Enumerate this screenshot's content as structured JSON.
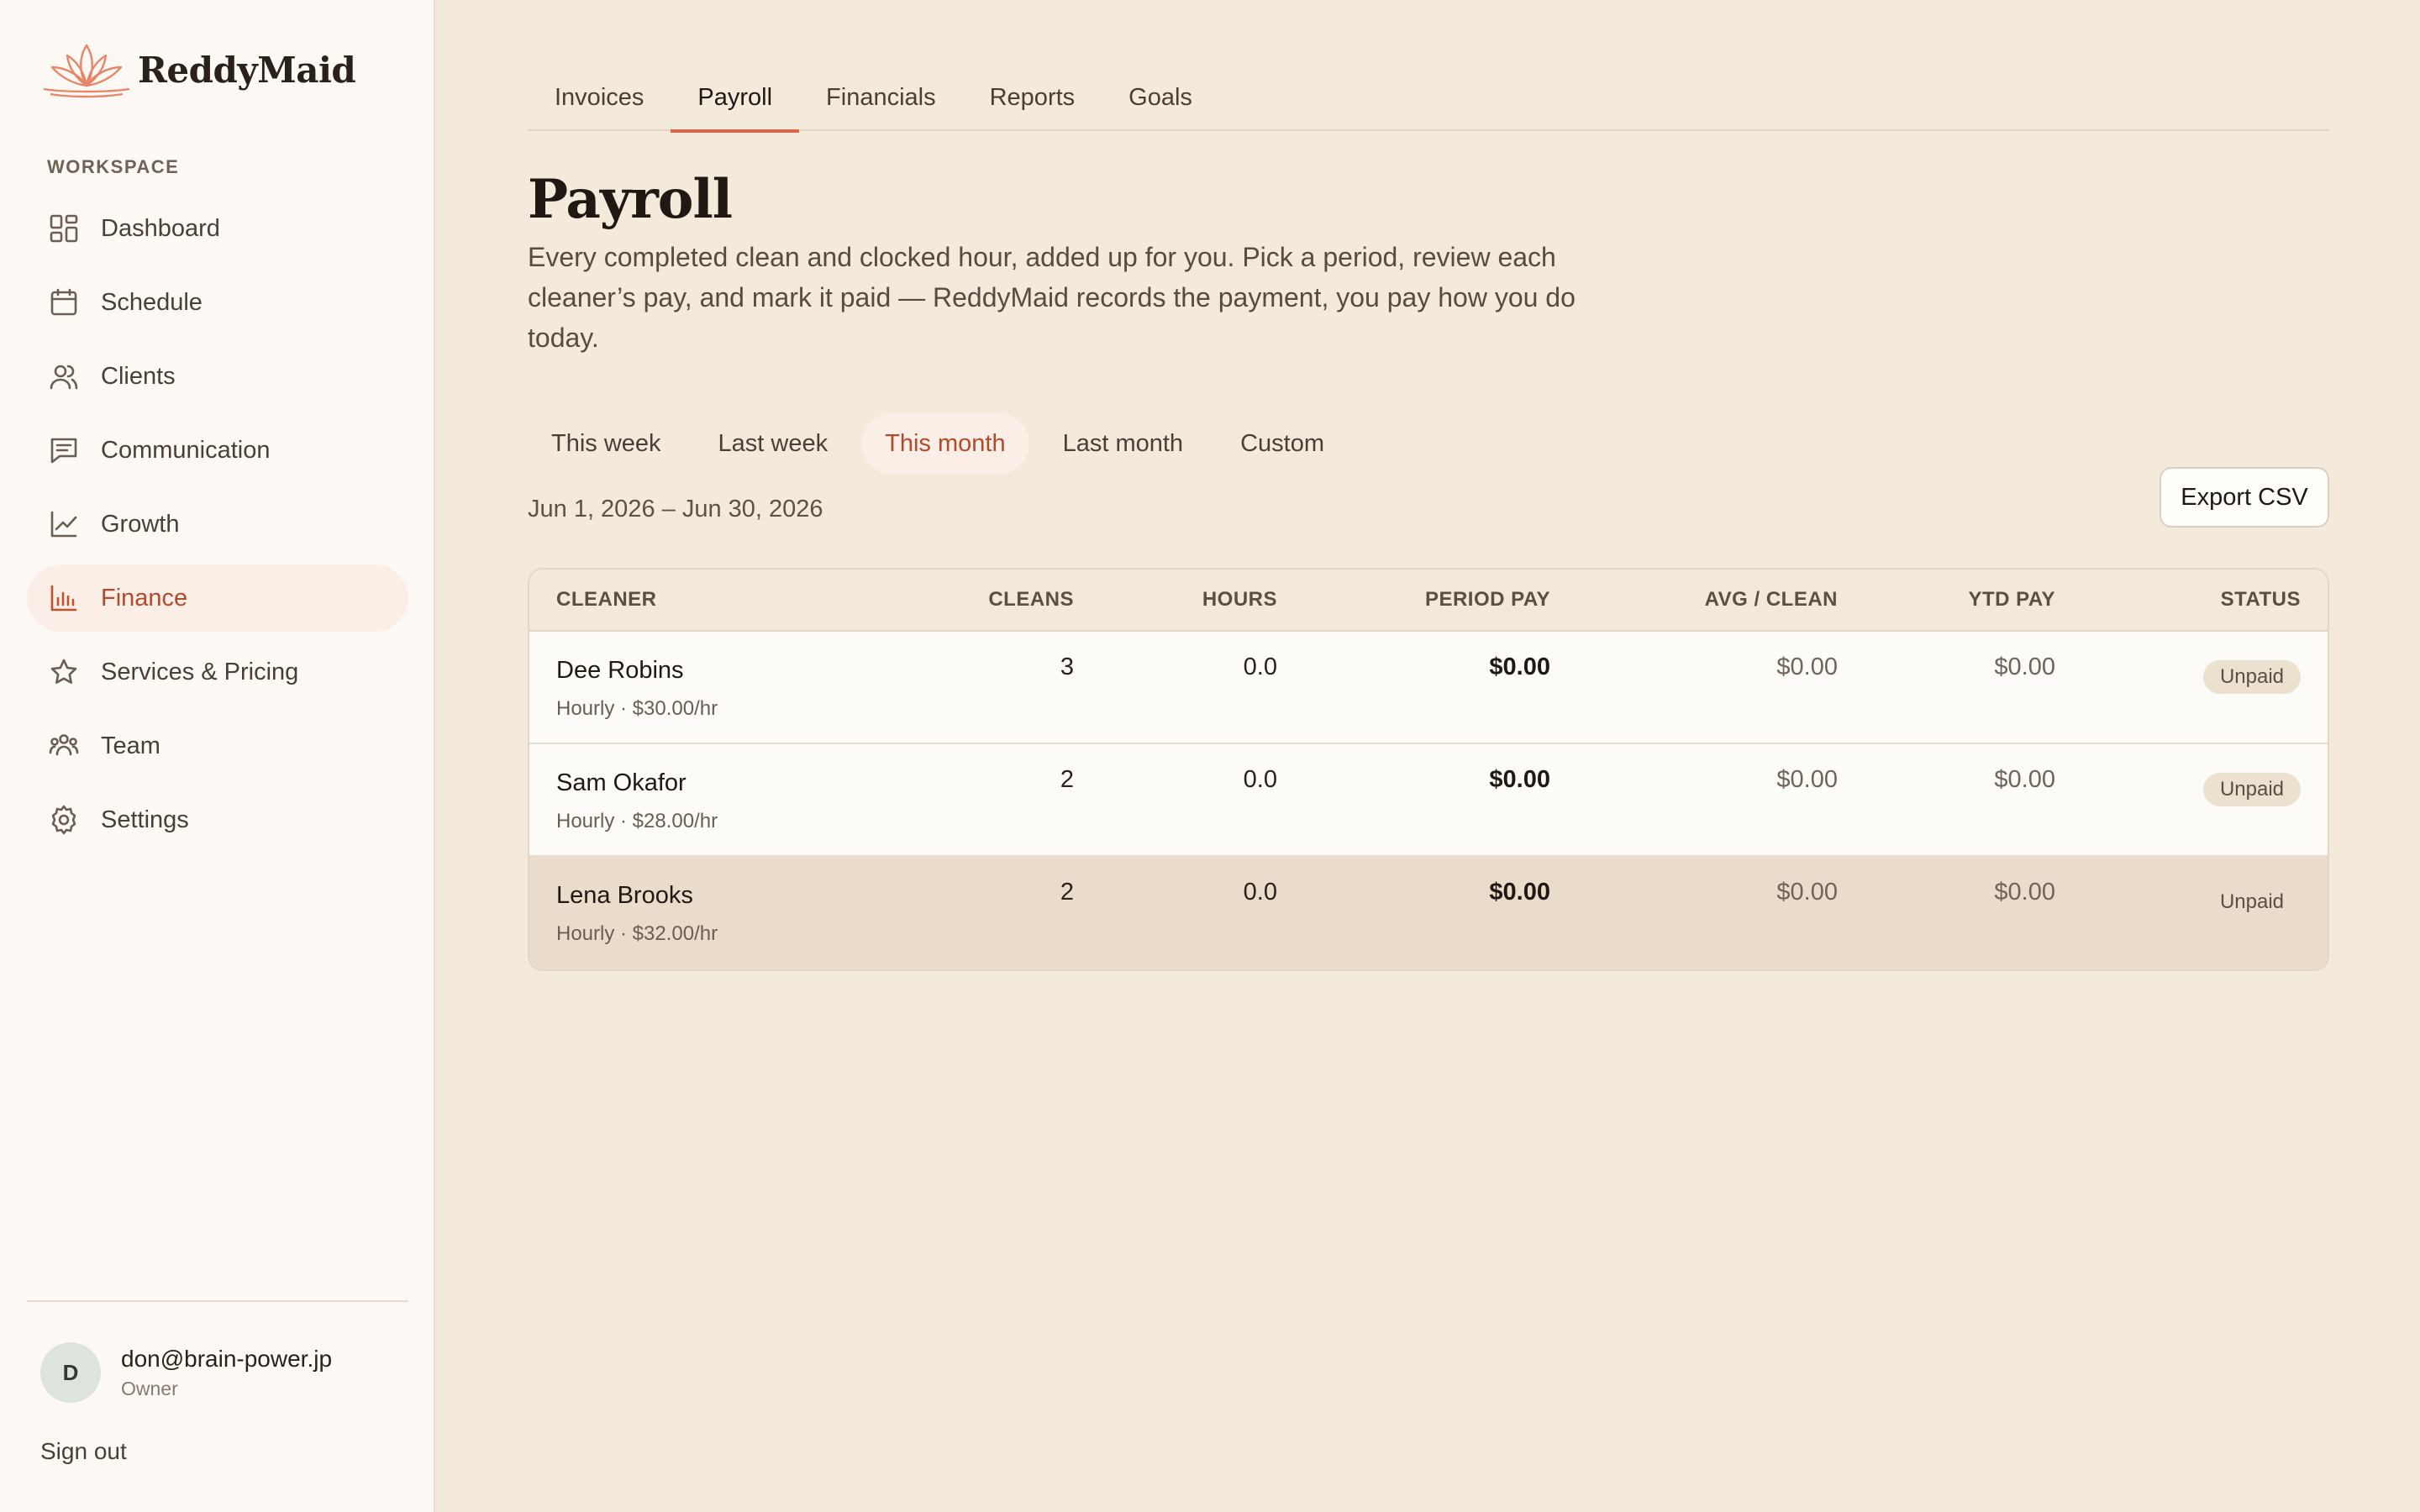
{
  "brand": {
    "name": "ReddyMaid",
    "accent": "#e07a5f"
  },
  "sidebar": {
    "section_label": "WORKSPACE",
    "items": [
      {
        "label": "Dashboard",
        "icon": "dashboard-grid-icon"
      },
      {
        "label": "Schedule",
        "icon": "calendar-icon"
      },
      {
        "label": "Clients",
        "icon": "users-icon"
      },
      {
        "label": "Communication",
        "icon": "message-icon"
      },
      {
        "label": "Growth",
        "icon": "trend-icon"
      },
      {
        "label": "Finance",
        "icon": "bar-chart-icon",
        "active": true
      },
      {
        "label": "Services & Pricing",
        "icon": "star-icon"
      },
      {
        "label": "Team",
        "icon": "team-icon"
      },
      {
        "label": "Settings",
        "icon": "gear-icon"
      }
    ],
    "user": {
      "initial": "D",
      "email": "don@brain-power.jp",
      "role": "Owner"
    },
    "sign_out": "Sign out"
  },
  "tabs": [
    {
      "label": "Invoices"
    },
    {
      "label": "Payroll",
      "active": true
    },
    {
      "label": "Financials"
    },
    {
      "label": "Reports"
    },
    {
      "label": "Goals"
    }
  ],
  "page": {
    "title": "Payroll",
    "description": "Every completed clean and clocked hour, added up for you. Pick a period, review each cleaner’s pay, and mark it paid — ReddyMaid records the payment, you pay how you do today."
  },
  "periods": [
    {
      "label": "This week"
    },
    {
      "label": "Last week"
    },
    {
      "label": "This month",
      "active": true
    },
    {
      "label": "Last month"
    },
    {
      "label": "Custom"
    }
  ],
  "date_range": "Jun 1, 2026 – Jun 30, 2026",
  "export_label": "Export CSV",
  "table": {
    "headers": {
      "cleaner": "CLEANER",
      "cleans": "CLEANS",
      "hours": "HOURS",
      "period_pay": "PERIOD PAY",
      "avg_clean": "AVG / CLEAN",
      "ytd_pay": "YTD PAY",
      "status": "STATUS"
    },
    "rows": [
      {
        "name": "Dee Robins",
        "rate": "Hourly · $30.00/hr",
        "cleans": "3",
        "hours": "0.0",
        "period_pay": "$0.00",
        "avg_clean": "$0.00",
        "ytd_pay": "$0.00",
        "status": "Unpaid"
      },
      {
        "name": "Sam Okafor",
        "rate": "Hourly · $28.00/hr",
        "cleans": "2",
        "hours": "0.0",
        "period_pay": "$0.00",
        "avg_clean": "$0.00",
        "ytd_pay": "$0.00",
        "status": "Unpaid"
      },
      {
        "name": "Lena Brooks",
        "rate": "Hourly · $32.00/hr",
        "cleans": "2",
        "hours": "0.0",
        "period_pay": "$0.00",
        "avg_clean": "$0.00",
        "ytd_pay": "$0.00",
        "status": "Unpaid"
      }
    ]
  }
}
